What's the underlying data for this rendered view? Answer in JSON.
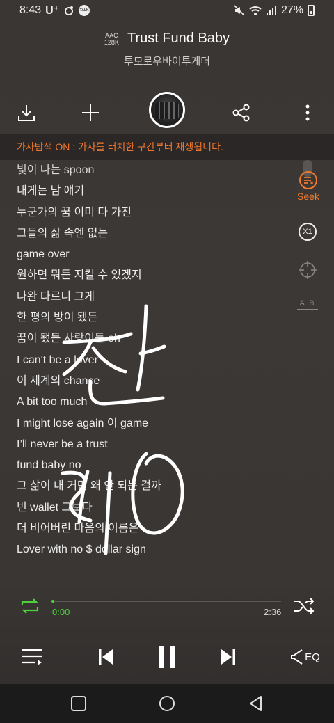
{
  "status_bar": {
    "time": "8:43",
    "carrier": "U⁺",
    "talk_badge": "TALK",
    "battery": "27%"
  },
  "header": {
    "codec_line1": "AAC",
    "codec_line2": "128K",
    "title": "Trust Fund Baby",
    "artist": "투모로우바이투게더"
  },
  "banner": {
    "text": "가사탐색 ON : 가사를 터치한 구간부터 재생됩니다."
  },
  "lyrics": [
    "빛이 나는 spoon",
    "내게는 남 얘기",
    "누군가의 꿈 이미 다 가진",
    "그들의 삶 속엔 없는",
    "game over",
    "원하면 뭐든 지킬 수 있겠지",
    "나완 다르니 그게",
    "한 평의 방이 됐든",
    "꿈이 됐든 사랑이든 oh",
    "I can't be a lover",
    "이 세계의 chance",
    "A bit too much",
    "I might lose again 이 game",
    "I’ll never be a trust",
    "fund baby no",
    "그 삶이 내 거면 왜 안 되는 걸까",
    "빈 wallet 그보다",
    "더 비어버린 마음의 이름은",
    "Lover with no $ dollar sign"
  ],
  "side_controls": {
    "seek_label": "Seek",
    "speed_label": "X1",
    "ab_label": "A B"
  },
  "player": {
    "current_time": "0:00",
    "total_time": "2:36",
    "progress_fraction": 0.0,
    "eq_label": "EQ"
  },
  "colors": {
    "accent_orange": "#f07a2d",
    "progress_green": "#4cd33a",
    "background": "#3a3634"
  },
  "icons": [
    "download-icon",
    "add-icon",
    "share-icon",
    "more-icon",
    "repeat-icon",
    "shuffle-icon",
    "playlist-icon",
    "previous-icon",
    "pause-icon",
    "next-icon",
    "eq-icon"
  ]
}
